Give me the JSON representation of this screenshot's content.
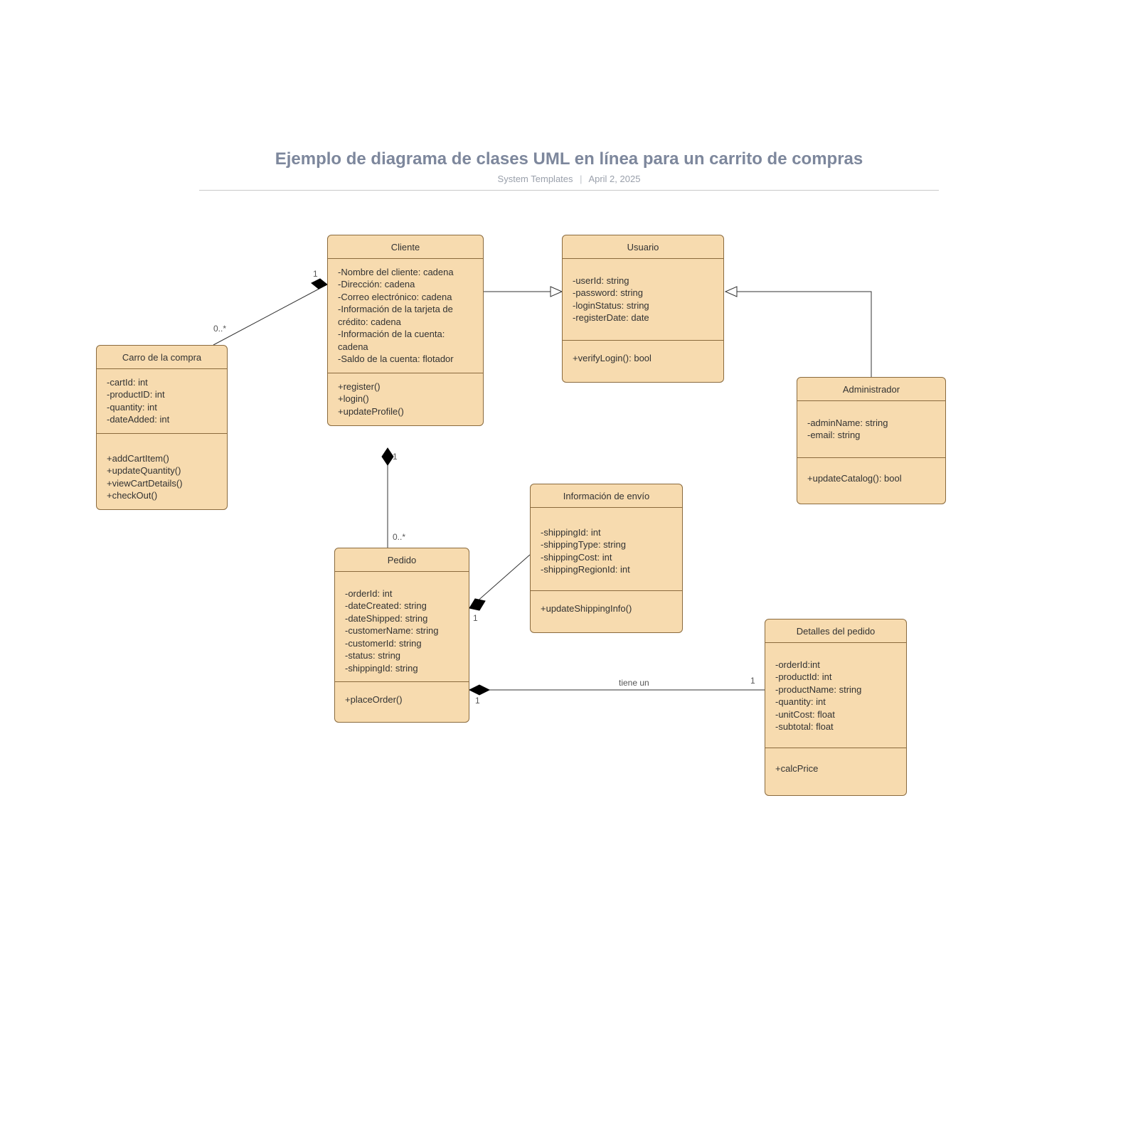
{
  "header": {
    "title": "Ejemplo de diagrama de clases UML en línea para un carrito de compras",
    "author": "System Templates",
    "date": "April 2, 2025"
  },
  "classes": {
    "carro": {
      "title": "Carro de la compra",
      "attrs": [
        "-cartId: int",
        "-productID: int",
        "-quantity: int",
        "-dateAdded: int"
      ],
      "ops": [
        "+addCartItem()",
        "+updateQuantity()",
        "+viewCartDetails()",
        "+checkOut()"
      ]
    },
    "cliente": {
      "title": "Cliente",
      "attrs": [
        "-Nombre del cliente: cadena",
        "-Dirección: cadena",
        "-Correo electrónico: cadena",
        "-Información de la tarjeta de crédito: cadena",
        "-Información de la cuenta: cadena",
        "-Saldo de la cuenta: flotador"
      ],
      "ops": [
        "+register()",
        "+login()",
        "+updateProfile()"
      ]
    },
    "usuario": {
      "title": "Usuario",
      "attrs": [
        "-userId: string",
        "-password: string",
        "-loginStatus: string",
        "-registerDate: date"
      ],
      "ops": [
        "+verifyLogin(): bool"
      ]
    },
    "admin": {
      "title": "Administrador",
      "attrs": [
        "-adminName: string",
        "-email: string"
      ],
      "ops": [
        "+updateCatalog(): bool"
      ]
    },
    "pedido": {
      "title": "Pedido",
      "attrs": [
        "-orderId: int",
        "-dateCreated: string",
        "-dateShipped: string",
        "-customerName: string",
        "-customerId: string",
        "-status: string",
        "-shippingId: string"
      ],
      "ops": [
        "+placeOrder()"
      ]
    },
    "envio": {
      "title": "Información de envío",
      "attrs": [
        "-shippingId: int",
        "-shippingType: string",
        "-shippingCost: int",
        "-shippingRegionId: int"
      ],
      "ops": [
        "+updateShippingInfo()"
      ]
    },
    "detalle": {
      "title": "Detalles del pedido",
      "attrs": [
        "-orderId:int",
        "-productId: int",
        "-productName: string",
        "-quantity: int",
        "-unitCost: float",
        "-subtotal: float"
      ],
      "ops": [
        "+calcPrice"
      ]
    }
  },
  "relations": {
    "cliente_carro": {
      "end1": "1",
      "end2": "0..*",
      "type": "composition"
    },
    "cliente_pedido": {
      "end1": "1",
      "end2": "0..*",
      "type": "composition"
    },
    "cliente_usuario": {
      "type": "generalization"
    },
    "admin_usuario": {
      "type": "generalization"
    },
    "pedido_envio": {
      "end1": "1",
      "end2": "1",
      "type": "composition"
    },
    "pedido_detalle": {
      "end1": "1",
      "end2": "1",
      "type": "composition",
      "label": "tiene un"
    }
  }
}
